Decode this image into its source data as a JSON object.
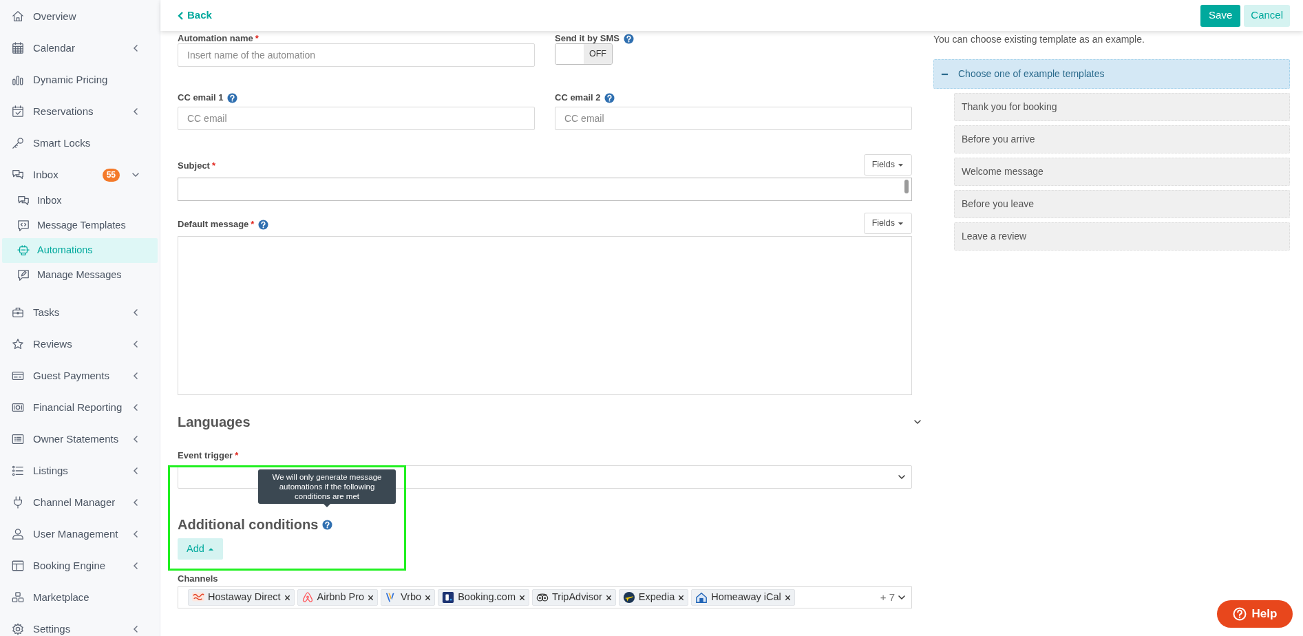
{
  "header": {
    "back": "Back",
    "save": "Save",
    "cancel": "Cancel"
  },
  "sidebar": {
    "items": [
      {
        "label": "Overview",
        "expandable": false
      },
      {
        "label": "Calendar",
        "expandable": true,
        "expanded": false
      },
      {
        "label": "Dynamic Pricing",
        "expandable": false
      },
      {
        "label": "Reservations",
        "expandable": true,
        "expanded": false
      },
      {
        "label": "Smart Locks",
        "expandable": false
      },
      {
        "label": "Inbox",
        "badge": "55",
        "expandable": true,
        "expanded": true,
        "children": [
          {
            "label": "Inbox",
            "selected": false
          },
          {
            "label": "Message Templates",
            "selected": false
          },
          {
            "label": "Automations",
            "selected": true
          },
          {
            "label": "Manage Messages",
            "selected": false
          }
        ]
      },
      {
        "label": "Tasks",
        "expandable": true,
        "expanded": false
      },
      {
        "label": "Reviews",
        "expandable": true,
        "expanded": false
      },
      {
        "label": "Guest Payments",
        "expandable": true,
        "expanded": false
      },
      {
        "label": "Financial Reporting",
        "expandable": true,
        "expanded": false
      },
      {
        "label": "Owner Statements",
        "expandable": true,
        "expanded": false
      },
      {
        "label": "Listings",
        "expandable": true,
        "expanded": false
      },
      {
        "label": "Channel Manager",
        "expandable": true,
        "expanded": false
      },
      {
        "label": "User Management",
        "expandable": true,
        "expanded": false
      },
      {
        "label": "Booking Engine",
        "expandable": true,
        "expanded": false
      },
      {
        "label": "Marketplace",
        "expandable": false
      },
      {
        "label": "Settings",
        "expandable": true,
        "expanded": false
      }
    ]
  },
  "form": {
    "automation_name": {
      "label": "Automation name",
      "required_mark": "*",
      "placeholder": "Insert name of the automation"
    },
    "sms": {
      "label": "Send it by SMS",
      "help": true,
      "on": false,
      "state_text": "OFF"
    },
    "cc_email_1": {
      "label": "CC email 1",
      "help": true,
      "placeholder": "CC email"
    },
    "cc_email_2": {
      "label": "CC email 2",
      "help": true,
      "placeholder": "CC email"
    },
    "subject": {
      "label": "Subject",
      "required_mark": "*",
      "fields_button": "Fields"
    },
    "default_message": {
      "label": "Default message",
      "required_mark": "*",
      "help": true,
      "fields_button": "Fields"
    },
    "languages": {
      "title": "Languages",
      "expanded": false
    },
    "event_trigger": {
      "label": "Event trigger",
      "required_mark": "*"
    },
    "additional_conditions": {
      "title": "Additional conditions",
      "tooltip": "We will only generate message automations if the following conditions are met",
      "add_button": "Add"
    },
    "channels": {
      "label": "Channels",
      "tags": [
        {
          "label": "Hostaway Direct"
        },
        {
          "label": "Airbnb Pro"
        },
        {
          "label": "Vrbo"
        },
        {
          "label": "Booking.com"
        },
        {
          "label": "TripAdvisor"
        },
        {
          "label": "Expedia"
        },
        {
          "label": "Homeaway iCal"
        }
      ],
      "more": "+ 7"
    }
  },
  "templates": {
    "hint": "You can choose existing template as an example.",
    "header": "Choose one of example templates",
    "expanded": true,
    "items": [
      {
        "label": "Thank you for booking"
      },
      {
        "label": "Before you arrive"
      },
      {
        "label": "Welcome message"
      },
      {
        "label": "Before you leave"
      },
      {
        "label": "Leave a review"
      }
    ]
  },
  "help_button": "Help"
}
